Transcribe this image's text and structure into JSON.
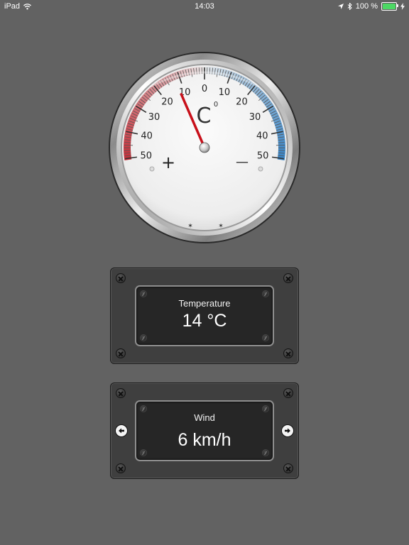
{
  "status_bar": {
    "device": "iPad",
    "time": "14:03",
    "battery": "100 %",
    "battery_level": 1.0,
    "icons": [
      "wifi-icon",
      "location-arrow-icon",
      "bluetooth-icon",
      "battery-icon",
      "charging-bolt-icon"
    ]
  },
  "thermometer": {
    "unit_symbol": "C",
    "degree_mark": "0",
    "left_scale_labels": [
      "10",
      "20",
      "30",
      "40",
      "50"
    ],
    "right_scale_labels": [
      "10",
      "20",
      "30",
      "40",
      "50"
    ],
    "center_label": "0",
    "plus_sign": "+",
    "minus_sign": "—",
    "needle_value": 12,
    "warm_color": "#c8303a",
    "cold_color": "#3a86c8"
  },
  "temperature_panel": {
    "label": "Temperature",
    "value": "14 °C"
  },
  "wind_panel": {
    "label": "Wind",
    "value": "6 km/h",
    "prev_icon": "arrow-left-icon",
    "next_icon": "arrow-right-icon"
  }
}
